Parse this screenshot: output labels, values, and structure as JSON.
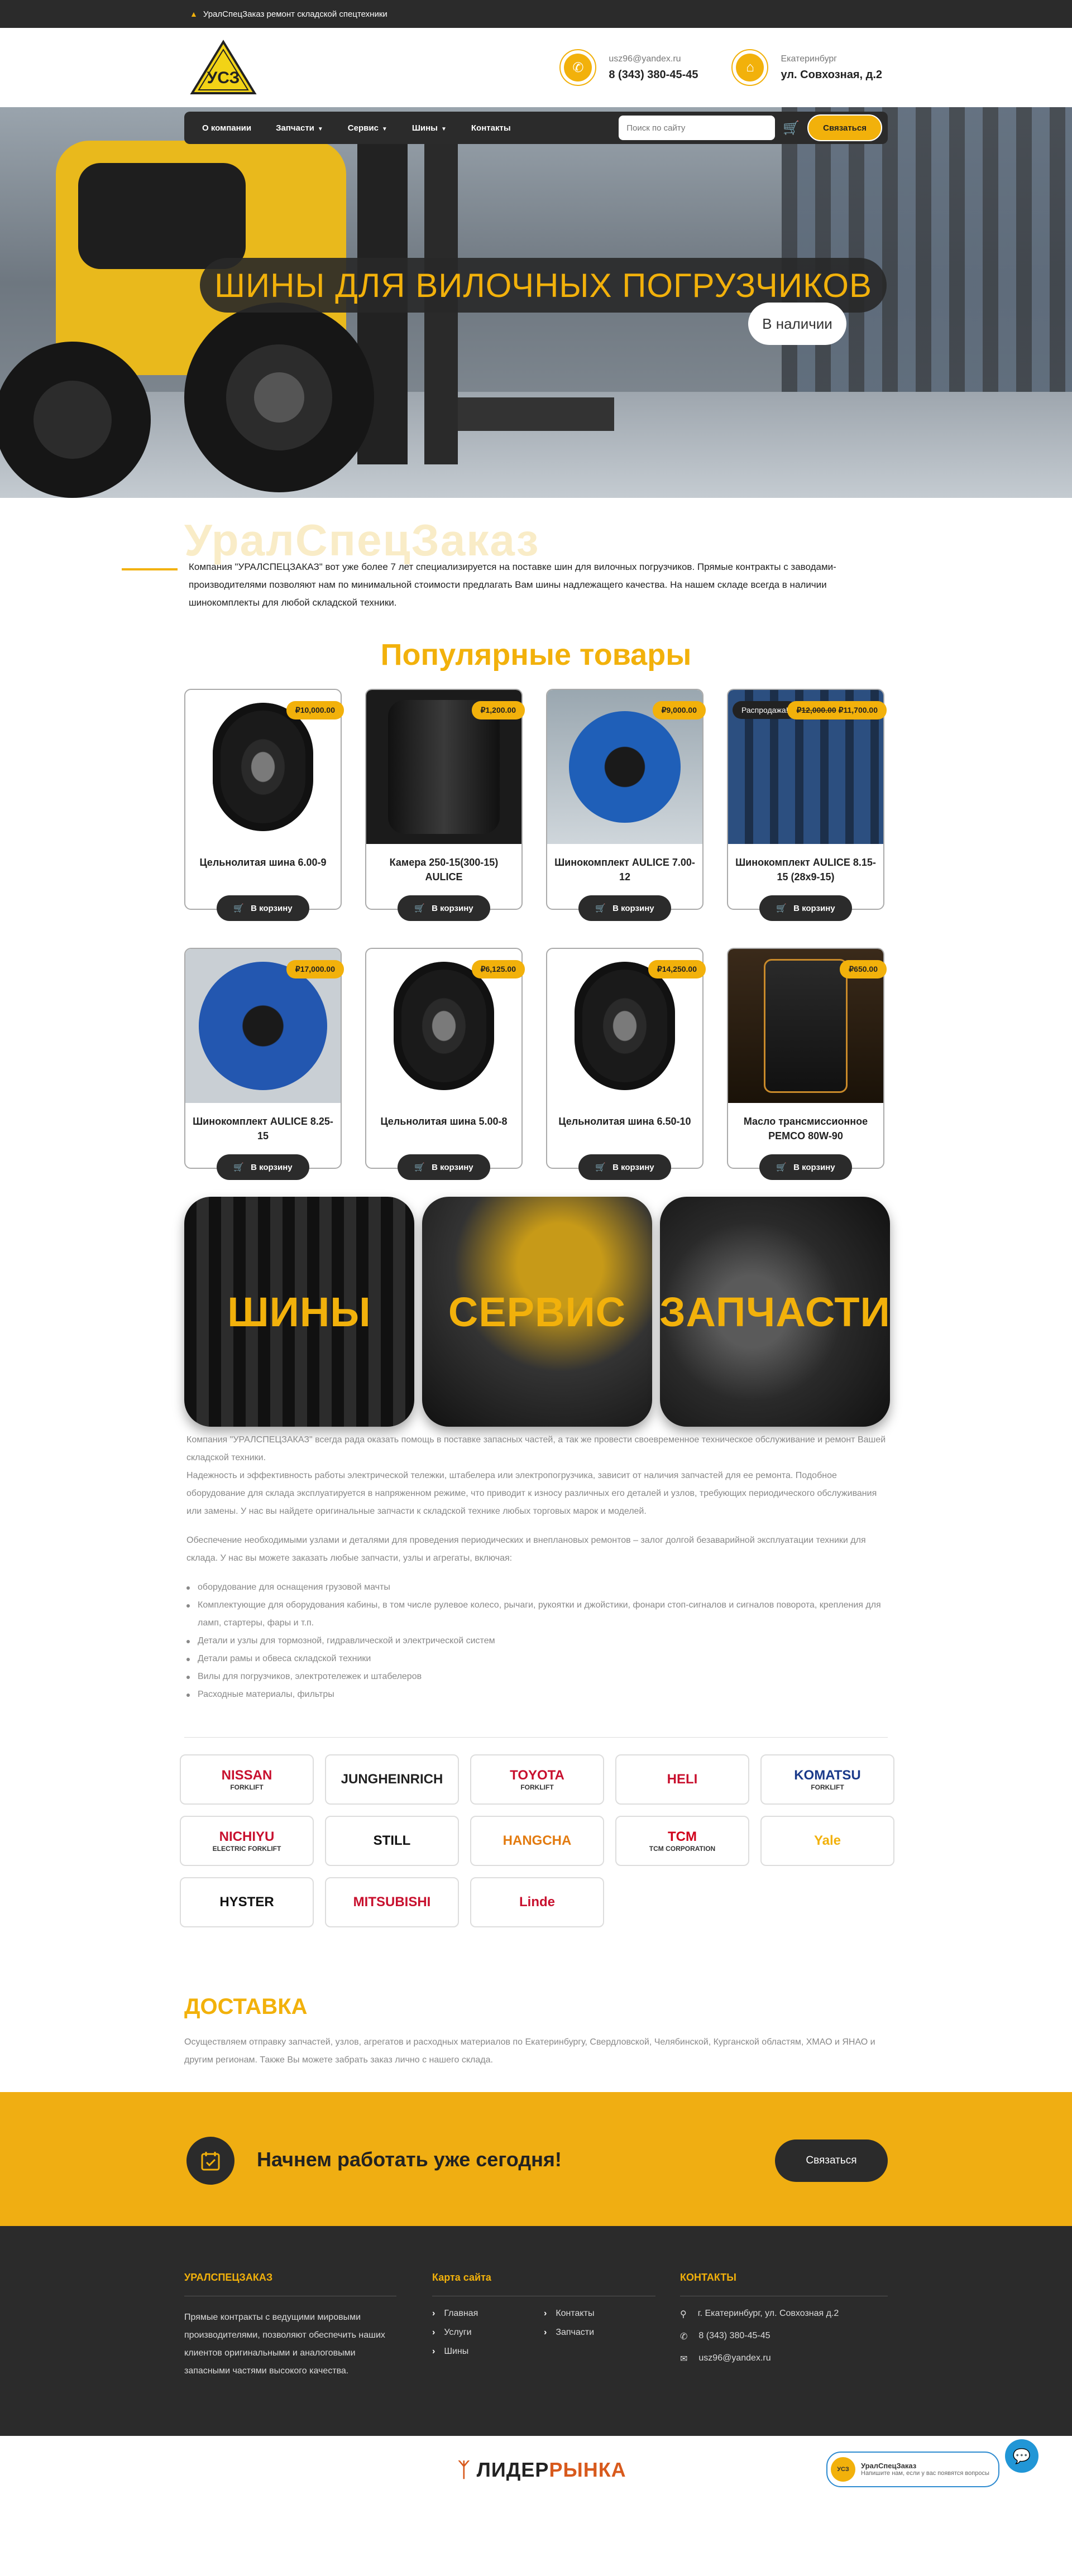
{
  "topbar": {
    "text": "УралСпецЗаказ ремонт складской спецтехники"
  },
  "header": {
    "logo_text": "УСЗ",
    "email": "usz96@yandex.ru",
    "phone": "8 (343) 380-45-45",
    "city": "Екатеринбург",
    "address": "ул. Совхозная, д.2"
  },
  "nav": {
    "items": [
      "О компании",
      "Запчасти",
      "Сервис",
      "Шины",
      "Контакты"
    ],
    "search_placeholder": "Поиск по сайту",
    "contact_button": "Связаться"
  },
  "hero": {
    "title": "ШИНЫ ДЛЯ ВИЛОЧНЫХ ПОГРУЗЧИКОВ",
    "badge": "В наличии"
  },
  "about": {
    "watermark": "УралСпецЗаказ",
    "text": "Компания \"УРАЛСПЕЦЗАКАЗ\" вот уже более 7 лет специализируется на поставке шин для вилочных погрузчиков. Прямые контракты с заводами-производителями  позволяют нам по минимальной стоимости  предлагать Вам шины надлежащего качества. На нашем складе всегда в наличии шинокомплекты для любой складской техники."
  },
  "popular": {
    "title": "Популярные товары",
    "buy_label": "В корзину",
    "sale_label": "Распродажа!",
    "products": [
      {
        "name": "Цельнолитая шина 6.00-9",
        "price": "₽10,000.00"
      },
      {
        "name": "Камера 250-15(300-15) AULICE",
        "price": "₽1,200.00"
      },
      {
        "name": "Шинокомплект AULICE 7.00-12",
        "price": "₽9,000.00"
      },
      {
        "name": "Шинокомплект AULICE 8.15-15 (28x9-15)",
        "old_price": "₽12,000.00",
        "price": "₽11,700.00"
      },
      {
        "name": "Шинокомплект AULICE 8.25-15",
        "price": "₽17,000.00"
      },
      {
        "name": "Цельнолитая шина 5.00-8",
        "price": "₽6,125.00"
      },
      {
        "name": "Цельнолитая шина 6.50-10",
        "price": "₽14,250.00"
      },
      {
        "name": "Масло трансмиссионное PEMCO 80W-90",
        "price": "₽650.00"
      }
    ]
  },
  "categories": [
    "ШИНЫ",
    "СЕРВИС",
    "ЗАПЧАСТИ"
  ],
  "info": {
    "p1": "Компания \"УРАЛСПЕЦЗАКАЗ\" всегда рада оказать помощь в поставке запасных частей, а так же провести своевременное техническое обслуживание и ремонт Вашей складской техники.",
    "p2": "Надежность и эффективность работы  электрической тележки, штабелера или электропогрузчика, зависит от наличия запчастей для ее ремонта. Подобное оборудование для склада эксплуатируется в напряженном режиме, что приводит к износу различных его деталей и узлов, требующих периодического обслуживания или замены. У нас вы найдете оригинальные запчасти к складской технике любых торговых марок и моделей.",
    "p3": "Обеспечение необходимыми узлами и деталями для проведения периодических и внеплановых ремонтов – залог долгой безаварийной эксплуатации техники для склада. У нас вы можете заказать любые запчасти, узлы и агрегаты, включая:",
    "list": [
      "оборудование для оснащения грузовой мачты",
      "Комплектующие для оборудования кабины, в том числе рулевое колесо, рычаги, рукоятки и джойстики, фонари стоп-сигналов и сигналов поворота, крепления для ламп, стартеры, фары и т.п.",
      "Детали и узлы для тормозной, гидравлической и электрической систем",
      "Детали рамы и обвеса складской техники",
      "Вилы для погрузчиков, электротележек и штабелеров",
      "Расходные материалы, фильтры"
    ]
  },
  "brands": [
    {
      "name": "NISSAN",
      "sub": "FORKLIFT",
      "color": "#c8102e"
    },
    {
      "name": "JUNGHEINRICH",
      "sub": "",
      "color": "#222222"
    },
    {
      "name": "TOYOTA",
      "sub": "FORKLIFT",
      "color": "#c8102e"
    },
    {
      "name": "HELI",
      "sub": "",
      "color": "#c8102e"
    },
    {
      "name": "KOMATSU",
      "sub": "FORKLIFT",
      "color": "#1a3a8a"
    },
    {
      "name": "NICHIYU",
      "sub": "ELECTRIC FORKLIFT",
      "color": "#c8102e"
    },
    {
      "name": "STILL",
      "sub": "",
      "color": "#111111"
    },
    {
      "name": "HANGCHA",
      "sub": "",
      "color": "#e37b10"
    },
    {
      "name": "TCM",
      "sub": "TCM CORPORATION",
      "color": "#d0021b"
    },
    {
      "name": "Yale",
      "sub": "",
      "color": "#f2b10b"
    },
    {
      "name": "HYSTER",
      "sub": "",
      "color": "#111111"
    },
    {
      "name": "MITSUBISHI",
      "sub": "",
      "color": "#c8102e"
    },
    {
      "name": "Linde",
      "sub": "",
      "color": "#c8102e"
    }
  ],
  "delivery": {
    "title": "ДОСТАВКА",
    "text": "Осуществляем отправку запчастей, узлов, агрегатов и расходных материалов по Екатеринбургу, Свердловской, Челябинской, Курганской областям, ХМАО и ЯНАО и другим регионам. Также Вы можете забрать заказ лично с нашего склада."
  },
  "cta": {
    "title": "Начнем работать уже сегодня!",
    "button": "Связаться"
  },
  "footer": {
    "col1_title": "УРАЛСПЕЦЗАКАЗ",
    "col1_text": "Прямые контракты с ведущими мировыми производителями, позволяют обеспечить наших клиентов оригинальными и аналоговыми запасными частями высокого качества.",
    "col2_title": "Карта сайта",
    "links": [
      "Главная",
      "Контакты",
      "Услуги",
      "Запчасти",
      "Шины"
    ],
    "col3_title": "КОНТАКТЫ",
    "address": "г. Екатеринбург, ул. Совхозная д.2",
    "phone": "8 (343) 380-45-45",
    "email": "usz96@yandex.ru"
  },
  "bottom": {
    "brand_left": "ЛИДЕР",
    "brand_right": "РЫНКА",
    "chat_name": "УралСпецЗаказ",
    "chat_text": "Напишите нам, если у вас появятся вопросы"
  },
  "colors": {
    "accent": "#f2b10b",
    "dark": "#2b2b2b"
  }
}
